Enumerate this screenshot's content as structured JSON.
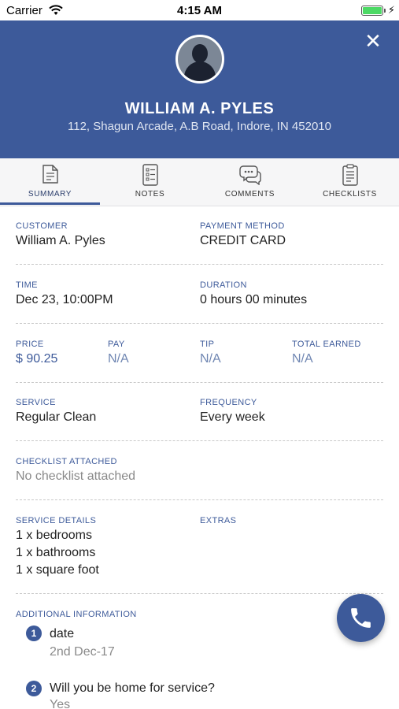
{
  "status": {
    "carrier": "Carrier",
    "time": "4:15 AM"
  },
  "header": {
    "name": "WILLIAM A. PYLES",
    "address": "112, Shagun Arcade, A.B Road, Indore, IN 452010",
    "close_icon": "close-icon"
  },
  "tabs": [
    {
      "label": "SUMMARY",
      "icon": "summary-icon",
      "active": true
    },
    {
      "label": "NOTES",
      "icon": "notes-icon"
    },
    {
      "label": "COMMENTS",
      "icon": "comments-icon"
    },
    {
      "label": "CHECKLISTS",
      "icon": "checklists-icon"
    }
  ],
  "summary": {
    "customer_label": "CUSTOMER",
    "customer": "William A. Pyles",
    "payment_label": "PAYMENT METHOD",
    "payment": "CREDIT CARD",
    "time_label": "TIME",
    "time": "Dec 23, 10:00PM",
    "duration_label": "DURATION",
    "duration": "0 hours 00 minutes",
    "price_label": "PRICE",
    "price": "$ 90.25",
    "pay_label": "PAY",
    "pay": "N/A",
    "tip_label": "TIP",
    "tip": "N/A",
    "total_label": "TOTAL EARNED",
    "total": "N/A",
    "service_label": "SERVICE",
    "service": "Regular Clean",
    "frequency_label": "FREQUENCY",
    "frequency": "Every week",
    "checklist_label": "CHECKLIST ATTACHED",
    "checklist": "No checklist attached",
    "service_details_label": "SERVICE DETAILS",
    "service_details": [
      "1 x bedrooms",
      "1 x bathrooms",
      "1 x square foot"
    ],
    "extras_label": "EXTRAS",
    "additional_label": "ADDITIONAL INFORMATION",
    "additional": [
      {
        "num": "1",
        "question": "date",
        "answer": "2nd Dec-17"
      },
      {
        "num": "2",
        "question": "Will you be home for service?",
        "answer": "Yes"
      }
    ]
  },
  "colors": {
    "brand": "#3d5a9a",
    "battery": "#4cd964"
  },
  "call_icon": "phone-icon"
}
